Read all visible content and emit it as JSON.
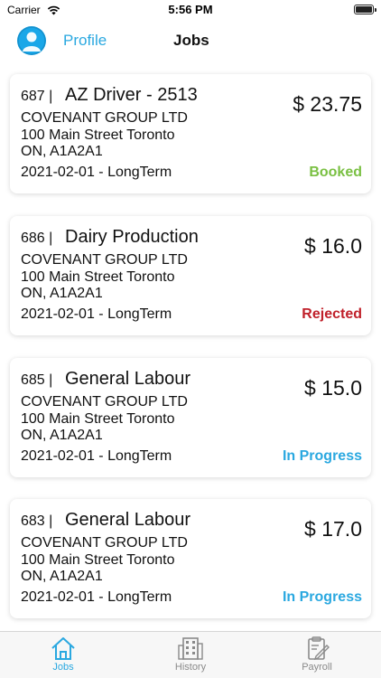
{
  "status_bar": {
    "carrier": "Carrier",
    "time": "5:56 PM"
  },
  "nav": {
    "profile_label": "Profile",
    "title": "Jobs"
  },
  "jobs": [
    {
      "id": "687 |",
      "title": "AZ Driver - 2513",
      "price": "$ 23.75",
      "company": "COVENANT GROUP LTD",
      "address_line1": "100 Main Street Toronto",
      "address_line2": "ON, A1A2A1",
      "date_term": "2021-02-01 - LongTerm",
      "status": "Booked",
      "status_color": "#7ac043"
    },
    {
      "id": "686 |",
      "title": "Dairy Production",
      "price": "$ 16.0",
      "company": "COVENANT GROUP LTD",
      "address_line1": "100 Main Street Toronto",
      "address_line2": "ON, A1A2A1",
      "date_term": "2021-02-01 - LongTerm",
      "status": "Rejected",
      "status_color": "#c0202a"
    },
    {
      "id": "685 |",
      "title": "General Labour",
      "price": "$ 15.0",
      "company": "COVENANT GROUP LTD",
      "address_line1": "100 Main Street Toronto",
      "address_line2": "ON, A1A2A1",
      "date_term": "2021-02-01 - LongTerm",
      "status": "In Progress",
      "status_color": "#2aa8e0"
    },
    {
      "id": "683 |",
      "title": "General Labour",
      "price": "$ 17.0",
      "company": "COVENANT GROUP LTD",
      "address_line1": "100 Main Street Toronto",
      "address_line2": "ON, A1A2A1",
      "date_term": "2021-02-01 - LongTerm",
      "status": "In Progress",
      "status_color": "#2aa8e0"
    }
  ],
  "tabs": [
    {
      "label": "Jobs",
      "icon": "home-icon",
      "active": true
    },
    {
      "label": "History",
      "icon": "building-icon",
      "active": false
    },
    {
      "label": "Payroll",
      "icon": "clipboard-edit-icon",
      "active": false
    }
  ],
  "colors": {
    "accent": "#2aa8e0",
    "booked": "#7ac043",
    "rejected": "#c0202a",
    "in_progress": "#2aa8e0",
    "tab_active": "#2aa8e0",
    "tab_inactive": "#8a8a8a"
  }
}
